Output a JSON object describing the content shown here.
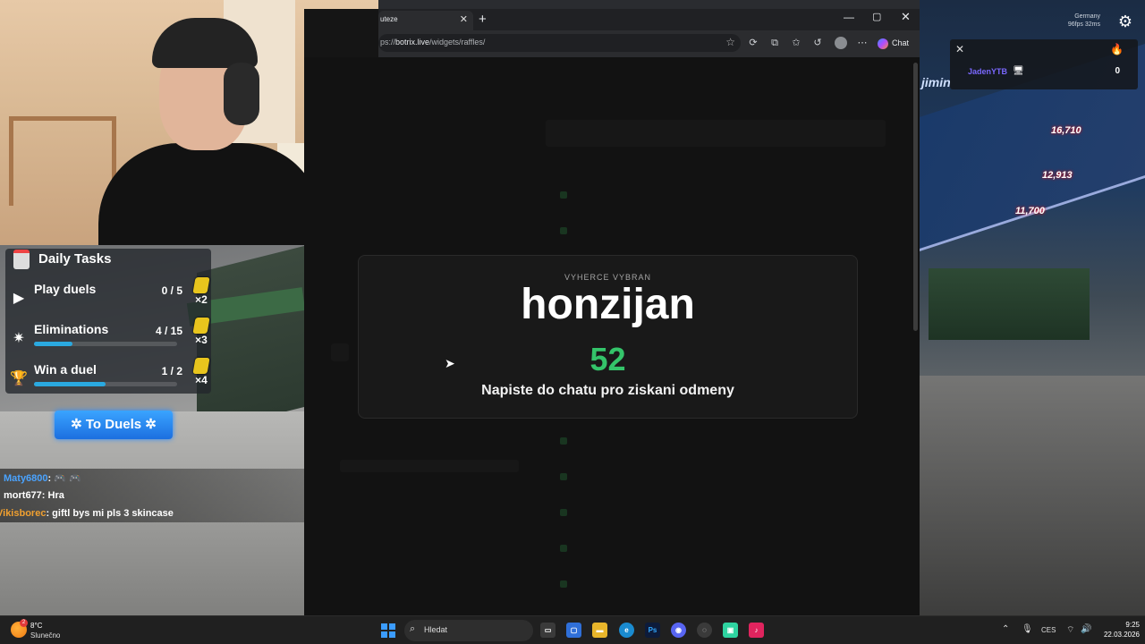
{
  "browser": {
    "tab_title": "uteze",
    "url_prefix": "ps://",
    "url_domain": "botrix.live",
    "url_path": "/widgets/raffles/",
    "chat_button": "Chat"
  },
  "raffle": {
    "label": "VYHERCE VYBRAN",
    "winner_name": "honzijan",
    "winner_number": "52",
    "message": "Napiste do chatu pro ziskani odmeny"
  },
  "daily_tasks": {
    "title": "Daily Tasks",
    "tasks": [
      {
        "label": "Play duels",
        "count": "0 / 5",
        "multiplier": "×2",
        "progress": 0
      },
      {
        "label": "Eliminations",
        "count": "4 / 15",
        "multiplier": "×3",
        "progress": 0.27
      },
      {
        "label": "Win a duel",
        "count": "1 / 2",
        "multiplier": "×4",
        "progress": 0.5
      }
    ],
    "to_duels": "To Duels"
  },
  "chat": [
    {
      "user": "Maty6800",
      "color": "#4aa3ff",
      "text": ": 🎮 🎮"
    },
    {
      "user": "mort677",
      "color": "#ffffff",
      "text": ": Hra"
    },
    {
      "user": "Vikisborec",
      "color": "#f0a030",
      "text": ": giftl bys mi pls 3 skincase"
    }
  ],
  "game": {
    "region": "Germany",
    "stats": "96fps 32ms",
    "player": "JadenYTB",
    "score": "0",
    "word": "jimin",
    "prices": [
      "16,710",
      "12,913",
      "11,700"
    ]
  },
  "taskbar": {
    "temperature": "8°C",
    "condition": "Slunečno",
    "badge": "2",
    "search_placeholder": "Hledat",
    "language": "CES",
    "time": "9:25",
    "date": "22.03.2026"
  }
}
